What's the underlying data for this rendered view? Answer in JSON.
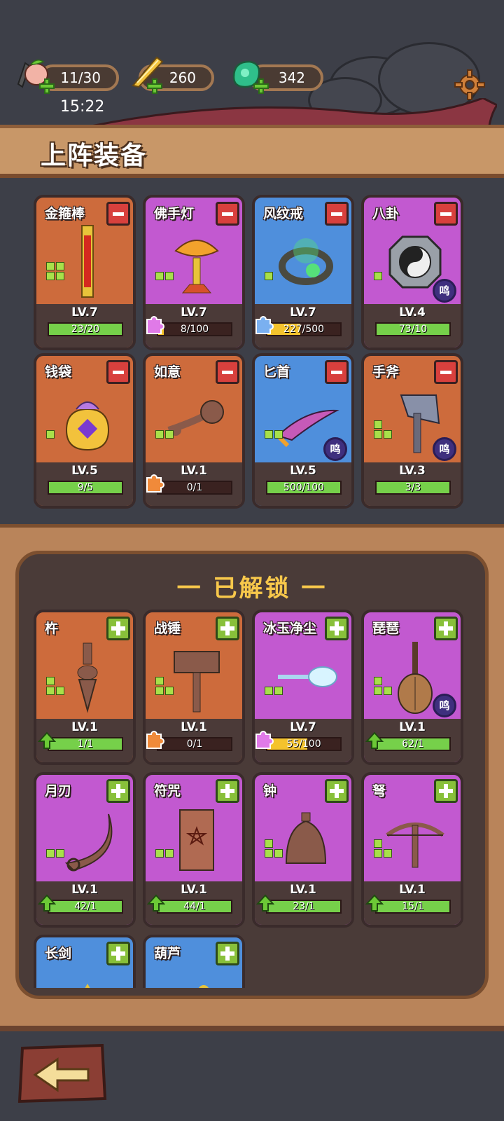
{
  "resources": [
    {
      "icon": "peach-icon",
      "value": "11/30"
    },
    {
      "icon": "gold-feather-icon",
      "value": "260"
    },
    {
      "icon": "jade-icon",
      "value": "342"
    }
  ],
  "clock": "15:22",
  "header": {
    "title": "上阵装备"
  },
  "equipped": [
    {
      "name": "金箍棒",
      "icon": "golden-staff-icon",
      "rarity": "orange",
      "level": "LV.7",
      "progress": "23/20",
      "fill": 1.0,
      "fill_color": "green",
      "pips": 4,
      "badge": null,
      "extra": null
    },
    {
      "name": "佛手灯",
      "icon": "lotus-lamp-icon",
      "rarity": "purple",
      "level": "LV.7",
      "progress": "8/100",
      "fill": 0.08,
      "fill_color": "yellow",
      "pips": 2,
      "badge": null,
      "extra": "puzzle"
    },
    {
      "name": "风纹戒",
      "icon": "wind-ring-icon",
      "rarity": "blue",
      "level": "LV.7",
      "progress": "227/500",
      "fill": 0.45,
      "fill_color": "yellow",
      "pips": 1,
      "badge": null,
      "extra": "puzzle"
    },
    {
      "name": "八卦",
      "icon": "bagua-icon",
      "rarity": "purple",
      "level": "LV.4",
      "progress": "73/10",
      "fill": 1.0,
      "fill_color": "green",
      "pips": 1,
      "badge": "鸣",
      "extra": null
    },
    {
      "name": "钱袋",
      "icon": "money-bag-icon",
      "rarity": "orange",
      "level": "LV.5",
      "progress": "9/5",
      "fill": 1.0,
      "fill_color": "green",
      "pips": 1,
      "badge": null,
      "extra": null
    },
    {
      "name": "如意",
      "icon": "ruyi-icon",
      "rarity": "orange",
      "level": "LV.1",
      "progress": "0/1",
      "fill": 0.0,
      "fill_color": "green",
      "pips": 2,
      "badge": null,
      "extra": "puzzle"
    },
    {
      "name": "匕首",
      "icon": "dagger-icon",
      "rarity": "blue",
      "level": "LV.5",
      "progress": "500/100",
      "fill": 1.0,
      "fill_color": "green",
      "pips": 2,
      "badge": "鸣",
      "extra": null
    },
    {
      "name": "手斧",
      "icon": "hand-axe-icon",
      "rarity": "orange",
      "level": "LV.3",
      "progress": "3/3",
      "fill": 1.0,
      "fill_color": "green",
      "pips": 3,
      "badge": "鸣",
      "extra": null
    }
  ],
  "unlocked_title": "一 已解锁 一",
  "unlocked": [
    {
      "name": "杵",
      "icon": "vajra-pestle-icon",
      "rarity": "orange",
      "level": "LV.1",
      "progress": "1/1",
      "fill": 1.0,
      "fill_color": "green",
      "pips": 3,
      "badge": null,
      "extra": "upgrade"
    },
    {
      "name": "战锤",
      "icon": "war-hammer-icon",
      "rarity": "orange",
      "level": "LV.1",
      "progress": "0/1",
      "fill": 0.0,
      "fill_color": "green",
      "pips": 3,
      "badge": null,
      "extra": "puzzle"
    },
    {
      "name": "冰玉净尘",
      "icon": "jade-whisk-icon",
      "rarity": "purple",
      "level": "LV.7",
      "progress": "55/100",
      "fill": 0.55,
      "fill_color": "yellow",
      "pips": 2,
      "badge": null,
      "extra": "puzzle"
    },
    {
      "name": "琵琶",
      "icon": "pipa-icon",
      "rarity": "purple",
      "level": "LV.1",
      "progress": "62/1",
      "fill": 1.0,
      "fill_color": "green",
      "pips": 3,
      "badge": "鸣",
      "extra": "upgrade"
    },
    {
      "name": "月刃",
      "icon": "moon-blade-icon",
      "rarity": "purple",
      "level": "LV.1",
      "progress": "42/1",
      "fill": 1.0,
      "fill_color": "green",
      "pips": 2,
      "badge": null,
      "extra": "upgrade"
    },
    {
      "name": "符咒",
      "icon": "talisman-icon",
      "rarity": "purple",
      "level": "LV.1",
      "progress": "44/1",
      "fill": 1.0,
      "fill_color": "green",
      "pips": 2,
      "badge": null,
      "extra": "upgrade"
    },
    {
      "name": "钟",
      "icon": "bell-icon",
      "rarity": "purple",
      "level": "LV.1",
      "progress": "23/1",
      "fill": 1.0,
      "fill_color": "green",
      "pips": 3,
      "badge": null,
      "extra": "upgrade"
    },
    {
      "name": "弩",
      "icon": "crossbow-icon",
      "rarity": "purple",
      "level": "LV.1",
      "progress": "15/1",
      "fill": 1.0,
      "fill_color": "green",
      "pips": 3,
      "badge": null,
      "extra": "upgrade"
    },
    {
      "name": "长剑",
      "icon": "long-sword-icon",
      "rarity": "blue",
      "level": "",
      "progress": "",
      "fill": 0,
      "fill_color": "green",
      "pips": 0,
      "badge": null,
      "extra": null
    },
    {
      "name": "葫芦",
      "icon": "gourd-icon",
      "rarity": "blue",
      "level": "",
      "progress": "",
      "fill": 0,
      "fill_color": "green",
      "pips": 0,
      "badge": null,
      "extra": null
    }
  ],
  "colors": {
    "orange": "#cd6b3c",
    "purple": "#c259d0",
    "blue": "#4f8fdc",
    "accent": "#f8c84b"
  }
}
